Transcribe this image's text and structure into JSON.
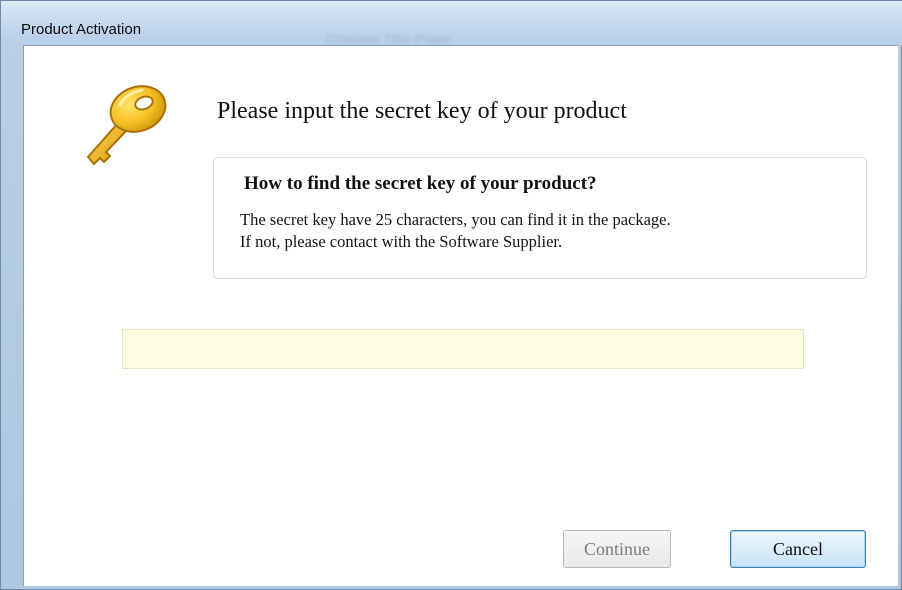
{
  "window": {
    "title": "Product Activation",
    "background_title": "Chapter Title Page"
  },
  "header": {
    "icon": "key-icon",
    "heading": "Please input the secret key of your product"
  },
  "info": {
    "title": "How to find the secret key of your product?",
    "line1": "The secret key have 25 characters, you can find it in the package.",
    "line2": "If not, please contact with the Software Supplier."
  },
  "key_input": {
    "value": "",
    "placeholder": ""
  },
  "buttons": {
    "continue_label": "Continue",
    "cancel_label": "Cancel"
  },
  "colors": {
    "input_background": "#fffde3",
    "key_gold": "#f2b51d",
    "cancel_border": "#3c7fb1"
  }
}
